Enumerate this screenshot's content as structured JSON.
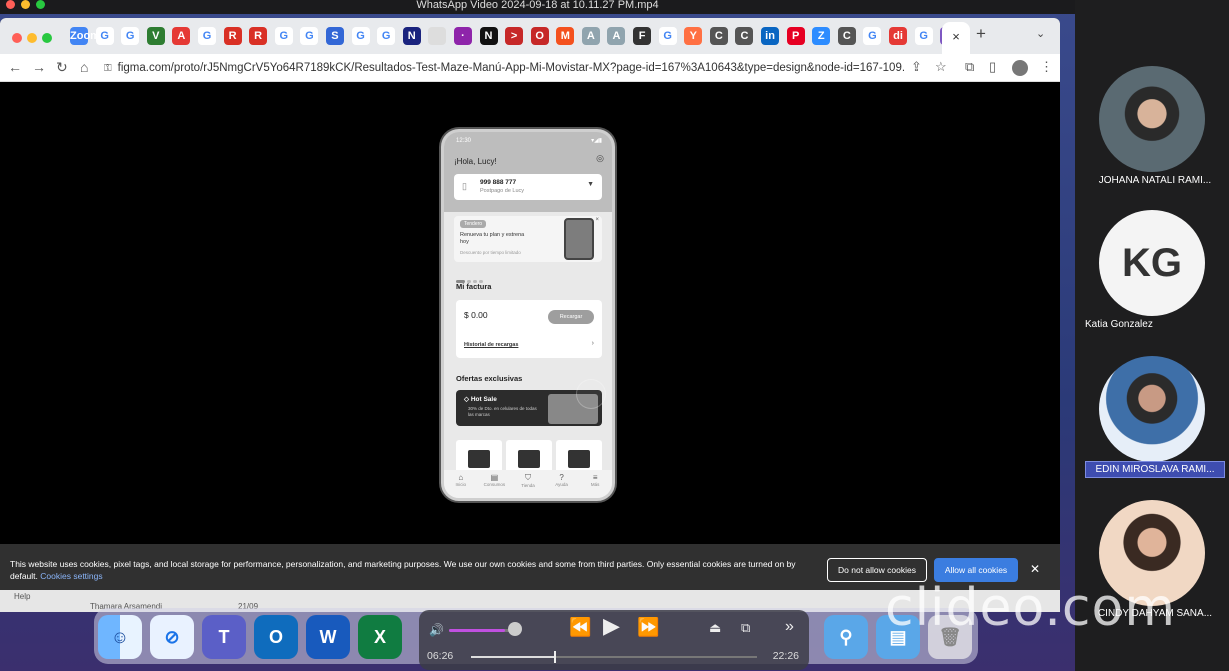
{
  "window_title": "WhatsApp Video 2024-09-18 at 10.11.27 PM.mp4",
  "browser": {
    "url": "figma.com/proto/rJ5NmgCrV5Yo64R7189kCK/Resultados-Test-Maze-Manú-App-Mi-Movistar-MX?page-id=167%3A10643&type=design&node-id=167-109...",
    "active_tab_close": "×",
    "new_tab": "+",
    "tab_icons": [
      "Zoom",
      "G",
      "G",
      "V",
      "A",
      "G",
      "R",
      "R",
      "G",
      "G",
      "S",
      "G",
      "G",
      "N",
      "",
      "·",
      "N",
      ">",
      "O",
      "M",
      "A",
      "A",
      "F",
      "G",
      "Y",
      "C",
      "C",
      "in",
      "P",
      "Z",
      "C",
      "G",
      "di",
      "G",
      "F"
    ]
  },
  "phone": {
    "status_time": "12:30",
    "greeting": "¡Hola, Lucy!",
    "line_number": "999 888 777",
    "line_sub": "Postpago de Lucy",
    "promo_badge": "Tendero",
    "promo_title": "Renueva tu plan y estrena hoy",
    "promo_sub": "Descuento por tiempo limitado",
    "factura_title": "Mi factura",
    "amount": "$ 0.00",
    "recharge_btn": "Recargar",
    "history_link": "Historial de recargas",
    "offers_title": "Ofertas exclusivas",
    "hotsale_title": "Hot Sale",
    "hotsale_sub": "30% de Dto. en celulares de todas las marcas",
    "nav": [
      "Inicio",
      "Consumos",
      "Tienda",
      "Ayuda",
      "Más"
    ]
  },
  "cookie": {
    "message": "This website uses cookies, pixel tags, and local storage for performance, personalization, and marketing purposes. We use our own cookies and some from third parties. Only essential cookies are turned on by default.",
    "settings_link": "Cookies settings",
    "deny_label": "Do not allow cookies",
    "allow_label": "Allow all cookies"
  },
  "participants": [
    {
      "name": "JOHANA NATALI RAMI..."
    },
    {
      "name": "Katia Gonzalez",
      "initials": "KG"
    },
    {
      "name": "EDIN MIROSLAVA RAMI..."
    },
    {
      "name": "CINDY DAHYAM SANA..."
    }
  ],
  "below_strip": {
    "help": "Help",
    "name": "Thamara Arsamendi",
    "time": "21/09"
  },
  "media": {
    "current_time": "06:26",
    "total_time": "22:26",
    "progress": 0.29,
    "volume": 0.88
  },
  "watermark": "clideo.com",
  "colors": {
    "allow": "#3b7de0",
    "volume": "#c050e0"
  }
}
